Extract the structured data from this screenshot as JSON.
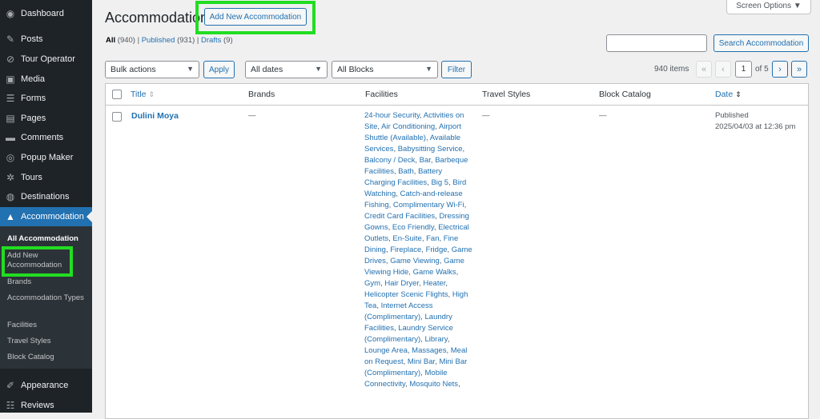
{
  "sidebar": {
    "items": [
      {
        "label": "Dashboard",
        "icon": "dashboard-icon",
        "glyph": "◉"
      },
      {
        "label": "Posts",
        "icon": "pin-icon",
        "glyph": "✎"
      },
      {
        "label": "Tour Operator",
        "icon": "compass-icon",
        "glyph": "⊘"
      },
      {
        "label": "Media",
        "icon": "media-icon",
        "glyph": "▣"
      },
      {
        "label": "Forms",
        "icon": "forms-icon",
        "glyph": "☰"
      },
      {
        "label": "Pages",
        "icon": "pages-icon",
        "glyph": "▤"
      },
      {
        "label": "Comments",
        "icon": "comment-icon",
        "glyph": "▬"
      },
      {
        "label": "Popup Maker",
        "icon": "popup-icon",
        "glyph": "◎"
      },
      {
        "label": "Tours",
        "icon": "palm-icon",
        "glyph": "✲"
      },
      {
        "label": "Destinations",
        "icon": "globe-icon",
        "glyph": "◍"
      },
      {
        "label": "Accommodation",
        "icon": "building-icon",
        "glyph": "▲"
      },
      {
        "label": "Appearance",
        "icon": "brush-icon",
        "glyph": "✐"
      },
      {
        "label": "Reviews",
        "icon": "list-icon",
        "glyph": "☷"
      }
    ],
    "submenu": [
      "All Accommodation",
      "Add New Accommodation",
      "Brands",
      "Accommodation Types",
      "Facilities",
      "Travel Styles",
      "Block Catalog"
    ]
  },
  "header": {
    "title": "Accommodation",
    "add_new": "Add New Accommodation",
    "screen_options": "Screen Options ▼"
  },
  "views": {
    "all": "All",
    "all_count": "(940)",
    "published": "Published",
    "published_count": "(931)",
    "drafts": "Drafts",
    "drafts_count": "(9)",
    "sep": "|"
  },
  "search": {
    "button": "Search Accommodation",
    "value": ""
  },
  "filters": {
    "bulk": "Bulk actions",
    "apply": "Apply",
    "dates": "All dates",
    "blocks": "All Blocks",
    "filter": "Filter"
  },
  "pagination": {
    "items": "940 items",
    "first": "«",
    "prev": "‹",
    "current": "1",
    "of": "of 5",
    "next": "›",
    "last": "»"
  },
  "table": {
    "columns": [
      "Title",
      "Brands",
      "Facilities",
      "Travel Styles",
      "Block Catalog",
      "Date"
    ],
    "row": {
      "title": "Dulini Moya",
      "brands": "—",
      "travel_styles": "—",
      "block_catalog": "—",
      "date_status": "Published",
      "date_value": "2025/04/03 at 12:36 pm",
      "facilities": [
        "24-hour Security",
        "Activities on Site",
        "Air Conditioning",
        "Airport Shuttle (Available)",
        "Available Services",
        "Babysitting Service",
        "Balcony / Deck",
        "Bar",
        "Barbeque Facilities",
        "Bath",
        "Battery Charging Facilities",
        "Big 5",
        "Bird Watching",
        "Catch-and-release Fishing",
        "Complimentary Wi-Fi",
        "Credit Card Facilities",
        "Dressing Gowns",
        "Eco Friendly",
        "Electrical Outlets",
        "En-Suite",
        "Fan",
        "Fine Dining",
        "Fireplace",
        "Fridge",
        "Game Drives",
        "Game Viewing",
        "Game Viewing Hide",
        "Game Walks",
        "Gym",
        "Hair Dryer",
        "Heater",
        "Helicopter Scenic Flights",
        "High Tea",
        "Internet Access (Complimentary)",
        "Laundry Facilities",
        "Laundry Service (Complimentary)",
        "Library",
        "Lounge Area",
        "Massages",
        "Meal on Request",
        "Mini Bar",
        "Mini Bar (Complimentary)",
        "Mobile Connectivity",
        "Mosquito Nets"
      ]
    }
  },
  "colors": {
    "highlight": "#22dd22",
    "accent": "#2271b1",
    "sidebar": "#1d2327"
  }
}
